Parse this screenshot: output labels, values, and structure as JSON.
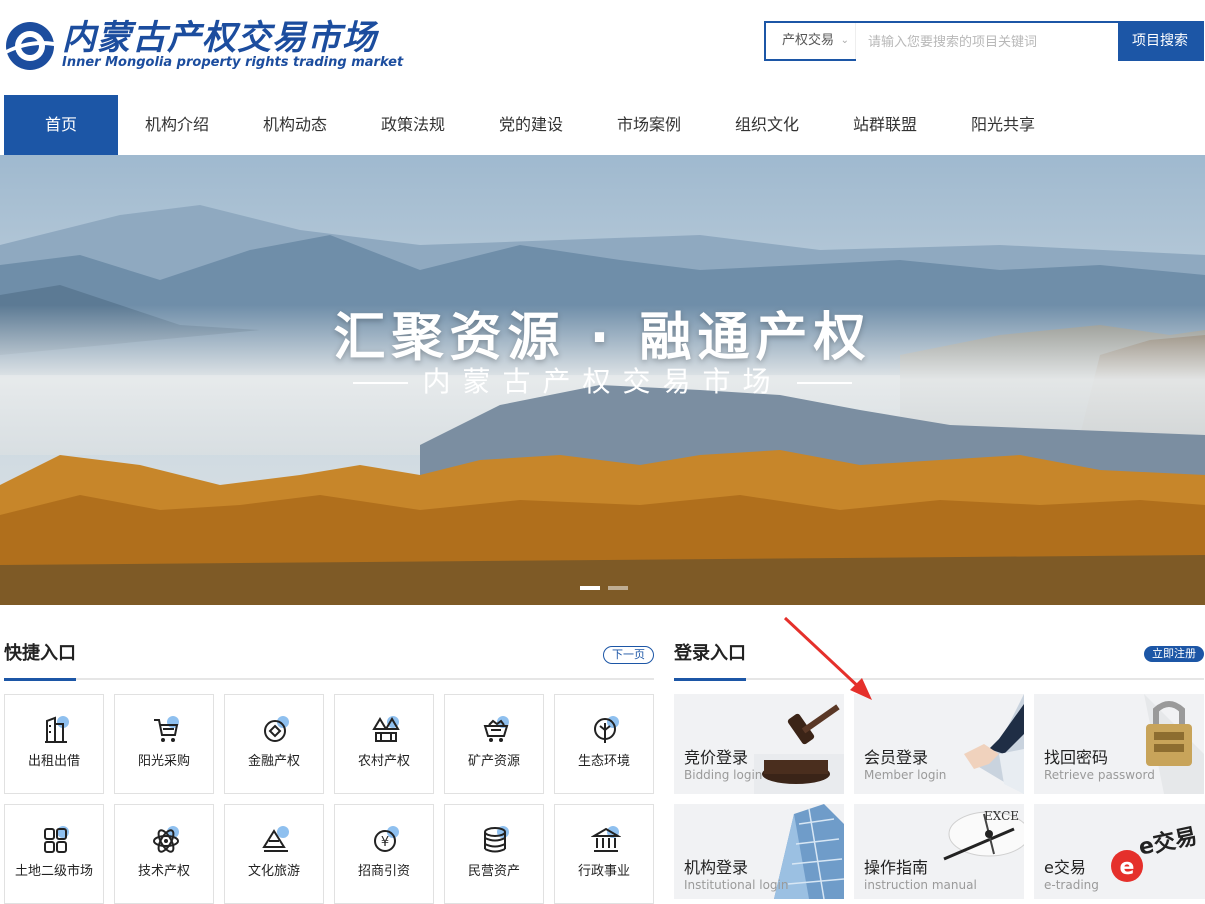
{
  "header": {
    "logo_cn": "内蒙古产权交易市场",
    "logo_en": "Inner Mongolia property rights trading market",
    "search": {
      "category": "产权交易",
      "placeholder": "请输入您要搜索的项目关键词",
      "button": "项目搜索"
    }
  },
  "nav": [
    {
      "label": "首页"
    },
    {
      "label": "机构介绍"
    },
    {
      "label": "机构动态"
    },
    {
      "label": "政策法规"
    },
    {
      "label": "党的建设"
    },
    {
      "label": "市场案例"
    },
    {
      "label": "组织文化"
    },
    {
      "label": "站群联盟"
    },
    {
      "label": "阳光共享"
    }
  ],
  "banner": {
    "title": "汇聚资源 · 融通产权",
    "subtitle": "内蒙古产权交易市场",
    "slide_count": 2,
    "active_slide": 1
  },
  "quick": {
    "title": "快捷入口",
    "more": "下一页",
    "items": [
      {
        "label": "出租出借",
        "icon": "building-icon"
      },
      {
        "label": "阳光采购",
        "icon": "cart-icon"
      },
      {
        "label": "金融产权",
        "icon": "finance-icon"
      },
      {
        "label": "农村产权",
        "icon": "farm-icon"
      },
      {
        "label": "矿产资源",
        "icon": "mine-cart-icon"
      },
      {
        "label": "生态环境",
        "icon": "leaf-icon"
      },
      {
        "label": "土地二级市场",
        "icon": "land-icon"
      },
      {
        "label": "技术产权",
        "icon": "atom-icon"
      },
      {
        "label": "文化旅游",
        "icon": "mountain-icon"
      },
      {
        "label": "招商引资",
        "icon": "yuan-icon"
      },
      {
        "label": "民营资产",
        "icon": "coins-icon"
      },
      {
        "label": "行政事业",
        "icon": "government-icon"
      }
    ]
  },
  "login": {
    "title": "登录入口",
    "more": "立即注册",
    "items": [
      {
        "cn": "竞价登录",
        "en": "Bidding login",
        "icon": "gavel-icon"
      },
      {
        "cn": "会员登录",
        "en": "Member login",
        "icon": "handshake-icon"
      },
      {
        "cn": "找回密码",
        "en": "Retrieve password",
        "icon": "padlock-icon"
      },
      {
        "cn": "机构登录",
        "en": "Institutional login",
        "icon": "skyscraper-icon"
      },
      {
        "cn": "操作指南",
        "en": "instruction manual",
        "icon": "compass-icon"
      },
      {
        "cn": "e交易",
        "en": "e-trading",
        "icon": "e-trade-logo-icon"
      }
    ]
  },
  "watermark": "e交易",
  "colors": {
    "brand_blue": "#1c56a6",
    "logo_blue": "#1c4d9e",
    "annotation_red": "#e5302b"
  }
}
